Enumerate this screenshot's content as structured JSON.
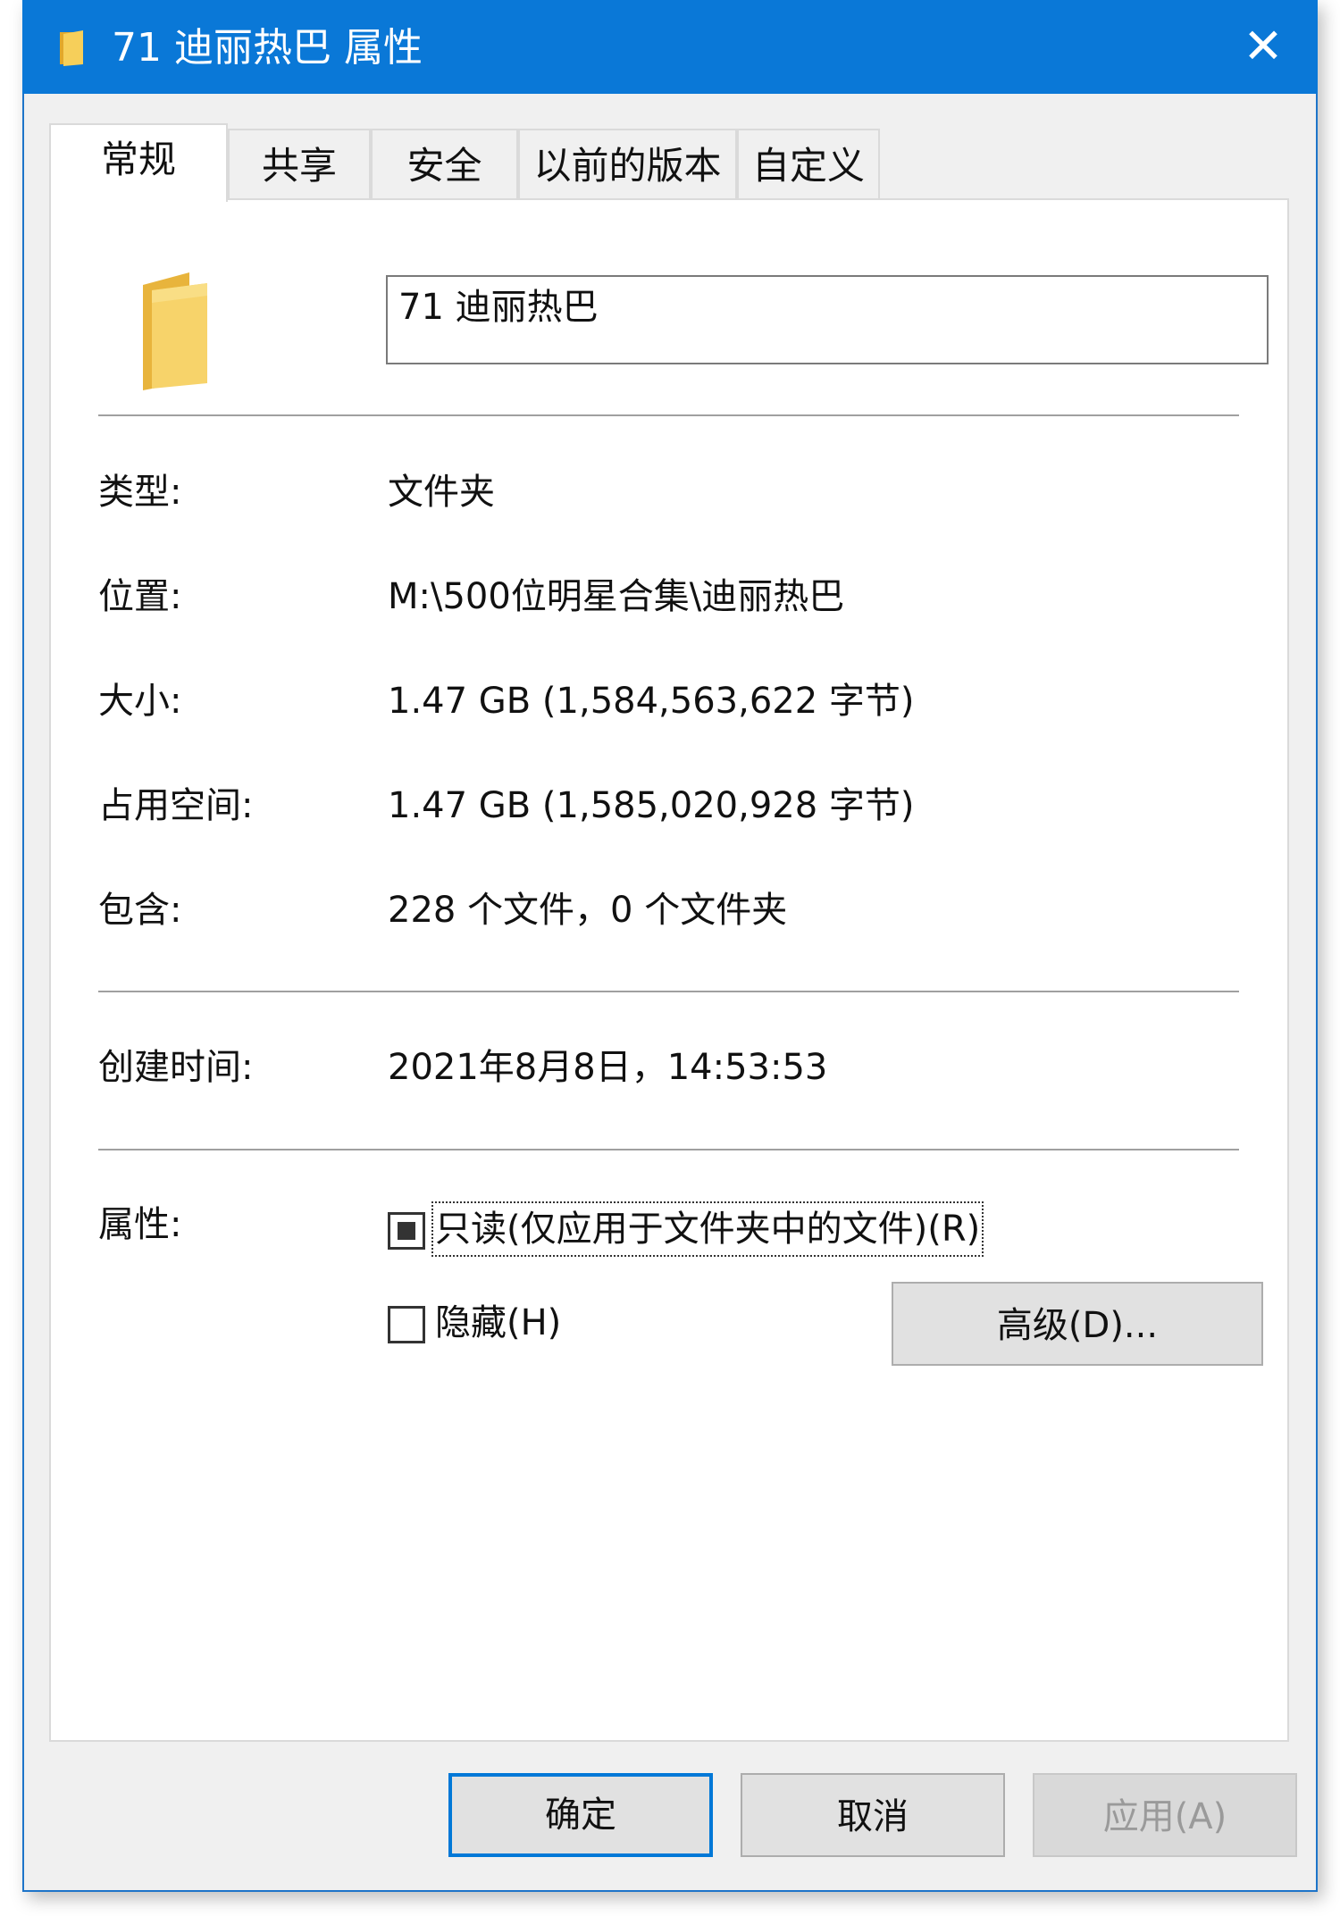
{
  "window": {
    "title": "71 迪丽热巴 属性",
    "close_glyph": "✕"
  },
  "tabs": [
    {
      "label": "常规",
      "active": true
    },
    {
      "label": "共享",
      "active": false
    },
    {
      "label": "安全",
      "active": false
    },
    {
      "label": "以前的版本",
      "active": false
    },
    {
      "label": "自定义",
      "active": false
    }
  ],
  "general": {
    "folder_name": "71 迪丽热巴",
    "icon": "folder-icon",
    "accent_color": "#0a78d7",
    "folder_color": "#f5c84c",
    "fields": [
      {
        "label": "类型:",
        "value": "文件夹"
      },
      {
        "label": "位置:",
        "value": "M:\\500位明星合集\\迪丽热巴"
      },
      {
        "label": "大小:",
        "value": "1.47 GB (1,584,563,622 字节)"
      },
      {
        "label": "占用空间:",
        "value": "1.47 GB (1,585,020,928 字节)"
      },
      {
        "label": "包含:",
        "value": "228 个文件，0 个文件夹"
      }
    ],
    "created": {
      "label": "创建时间:",
      "value": "2021年8月8日，14:53:53"
    },
    "attributes": {
      "label": "属性:",
      "readonly": {
        "label": "只读(仅应用于文件夹中的文件)(R)",
        "state": "indeterminate"
      },
      "hidden": {
        "label": "隐藏(H)",
        "checked": false
      },
      "advanced_button": "高级(D)..."
    }
  },
  "buttons": {
    "ok": "确定",
    "cancel": "取消",
    "apply": "应用(A)"
  }
}
